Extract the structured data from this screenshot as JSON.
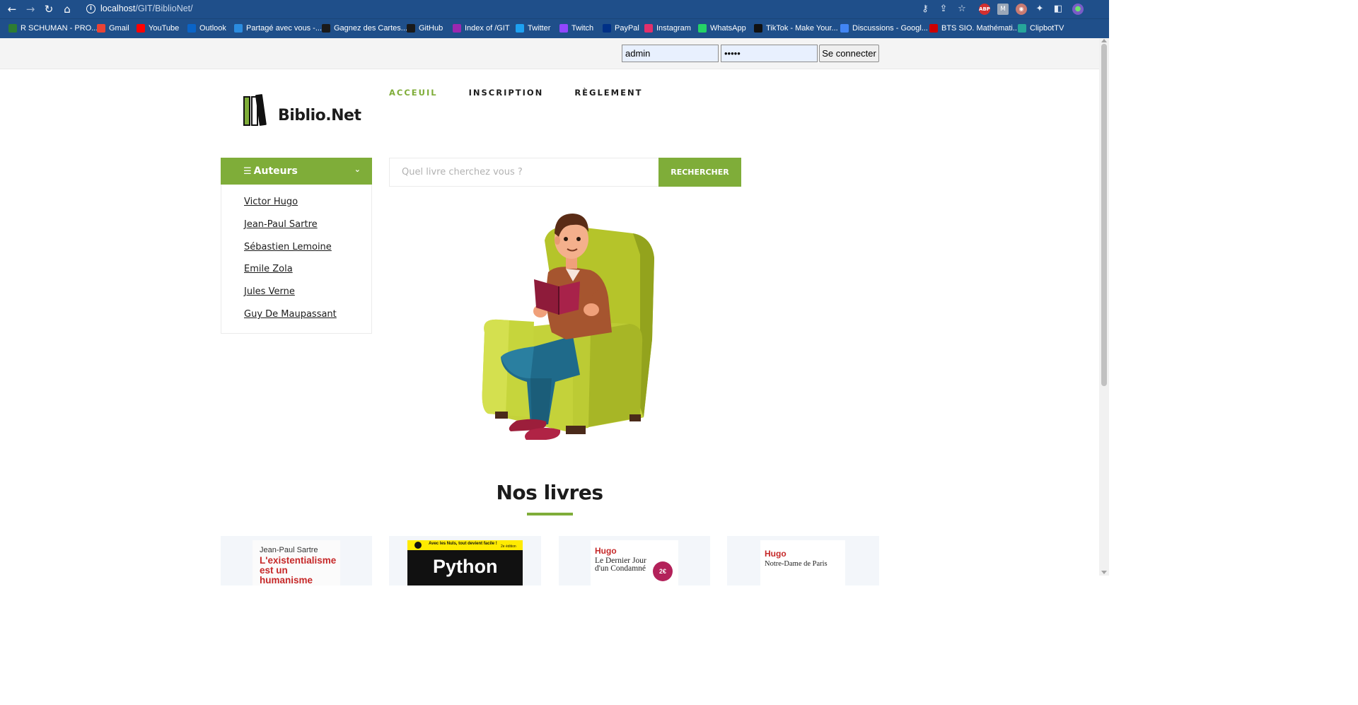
{
  "browser": {
    "url_host": "localhost",
    "url_path": "/GIT/BiblioNet/",
    "bookmarks": [
      {
        "label": "R SCHUMAN - PRO...",
        "icon": "hot-icon",
        "color": "#2e7d32"
      },
      {
        "label": "Gmail",
        "icon": "gmail-icon",
        "color": "#ea4335"
      },
      {
        "label": "YouTube",
        "icon": "youtube-icon",
        "color": "#ff0000"
      },
      {
        "label": "Outlook",
        "icon": "outlook-icon",
        "color": "#0a64c8"
      },
      {
        "label": "Partagé avec vous -...",
        "icon": "onedrive-icon",
        "color": "#2b8ce0"
      },
      {
        "label": "Gagnez des Cartes...",
        "icon": "target-icon",
        "color": "#1a1a1a"
      },
      {
        "label": "GitHub",
        "icon": "github-icon",
        "color": "#1a1a1a"
      },
      {
        "label": "Index of /GIT",
        "icon": "globe-icon",
        "color": "#9c27b0"
      },
      {
        "label": "Twitter",
        "icon": "twitter-icon",
        "color": "#1da1f2"
      },
      {
        "label": "Twitch",
        "icon": "twitch-icon",
        "color": "#9146ff"
      },
      {
        "label": "PayPal",
        "icon": "paypal-icon",
        "color": "#003087"
      },
      {
        "label": "Instagram",
        "icon": "instagram-icon",
        "color": "#e1306c"
      },
      {
        "label": "WhatsApp",
        "icon": "whatsapp-icon",
        "color": "#25d366"
      },
      {
        "label": "TikTok - Make Your...",
        "icon": "tiktok-icon",
        "color": "#111111"
      },
      {
        "label": "Discussions - Googl...",
        "icon": "docs-icon",
        "color": "#4285f4"
      },
      {
        "label": "BTS SIO. Mathémati...",
        "icon": "free-icon",
        "color": "#cc0000"
      },
      {
        "label": "ClipbotTV",
        "icon": "cloud-icon",
        "color": "#26a69a"
      }
    ]
  },
  "login": {
    "username_value": "admin",
    "password_value": "•••••",
    "submit_label": "Se connecter"
  },
  "site": {
    "logo_text": "Biblio.Net",
    "nav": [
      "ACCEUIL",
      "INSCRIPTION",
      "RÈGLEMENT"
    ]
  },
  "sidebar": {
    "title": "Auteurs",
    "authors": [
      "Victor Hugo",
      "Jean-Paul Sartre",
      "Sébastien Lemoine",
      "Emile Zola",
      "Jules Verne",
      "Guy De Maupassant"
    ]
  },
  "search": {
    "placeholder": "Quel livre cherchez vous ?",
    "button_label": "RECHERCHER"
  },
  "section": {
    "title": "Nos livres"
  },
  "books": [
    {
      "author": "Jean-Paul Sartre",
      "title": "L'existentialisme est un humanisme"
    },
    {
      "banner": "Avec les Nuls, tout devient facile !",
      "edition": "2e édition",
      "title": "Python"
    },
    {
      "author": "Hugo",
      "title": "Le Dernier Jour d'un Condamné",
      "price": "2€"
    },
    {
      "author": "Hugo",
      "title": "Notre-Dame de Paris"
    }
  ],
  "colors": {
    "accent": "#7fad39",
    "browser_bar": "#1f4f8a"
  }
}
